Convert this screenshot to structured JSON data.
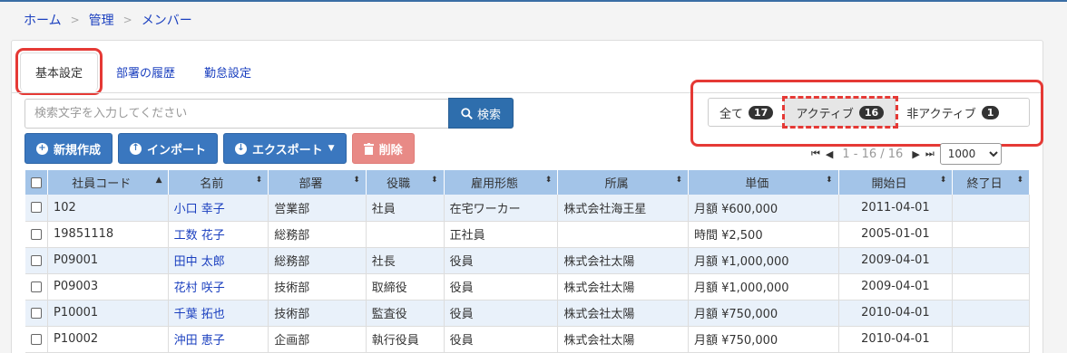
{
  "breadcrumb": [
    "ホーム",
    "管理",
    "メンバー"
  ],
  "tabs": [
    "基本設定",
    "部署の履歴",
    "勤怠設定"
  ],
  "search": {
    "placeholder": "検索文字を入力してください",
    "button": "検索"
  },
  "filters": [
    {
      "label": "全て",
      "count": "17"
    },
    {
      "label": "アクティブ",
      "count": "16"
    },
    {
      "label": "非アクティブ",
      "count": "1"
    }
  ],
  "toolbar": {
    "new": "新規作成",
    "import": "インポート",
    "export": "エクスポート",
    "delete": "削除"
  },
  "pager": {
    "info": "1 - 16 / 16",
    "page_size": "1000"
  },
  "columns": [
    "社員コード",
    "名前",
    "部署",
    "役職",
    "雇用形態",
    "所属",
    "単価",
    "開始日",
    "終了日"
  ],
  "rows": [
    [
      "102",
      "小口 幸子",
      "営業部",
      "社員",
      "在宅ワーカー",
      "株式会社海王星",
      "月額 ¥600,000",
      "2011-04-01",
      ""
    ],
    [
      "19851118",
      "工数 花子",
      "総務部",
      "",
      "正社員",
      "",
      "時間 ¥2,500",
      "2005-01-01",
      ""
    ],
    [
      "P09001",
      "田中 太郎",
      "総務部",
      "社長",
      "役員",
      "株式会社太陽",
      "月額 ¥1,000,000",
      "2009-04-01",
      ""
    ],
    [
      "P09003",
      "花村 咲子",
      "技術部",
      "取締役",
      "役員",
      "株式会社太陽",
      "月額 ¥1,000,000",
      "2009-04-01",
      ""
    ],
    [
      "P10001",
      "千葉 拓也",
      "技術部",
      "監査役",
      "役員",
      "株式会社太陽",
      "月額 ¥750,000",
      "2010-04-01",
      ""
    ],
    [
      "P10002",
      "沖田 恵子",
      "企画部",
      "執行役員",
      "役員",
      "株式会社太陽",
      "月額 ¥750,000",
      "2010-04-01",
      ""
    ]
  ]
}
